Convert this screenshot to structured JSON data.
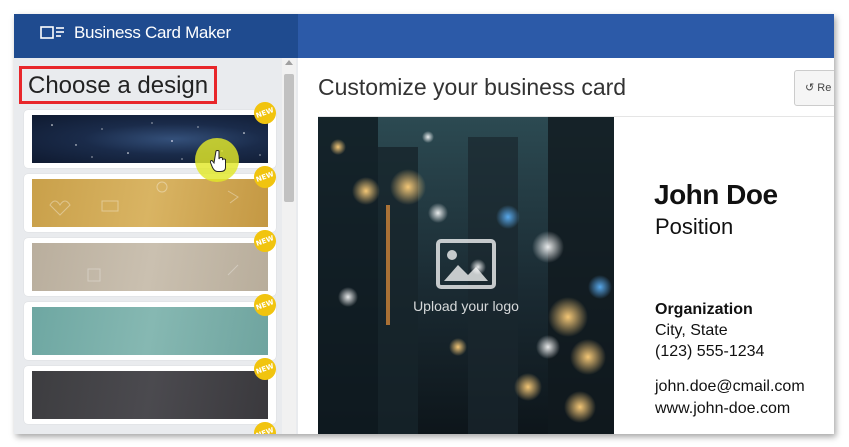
{
  "app": {
    "title": "Business Card Maker"
  },
  "sidebar": {
    "title": "Choose a design",
    "badge_label": "NEW",
    "designs": [
      {
        "name": "night-sky",
        "badge": "NEW"
      },
      {
        "name": "gold",
        "badge": "NEW"
      },
      {
        "name": "taupe",
        "badge": "NEW"
      },
      {
        "name": "teal",
        "badge": "NEW"
      },
      {
        "name": "charcoal",
        "badge": "NEW"
      }
    ]
  },
  "main": {
    "title": "Customize your business card",
    "reset_label": "Re"
  },
  "card": {
    "upload_label": "Upload your logo",
    "name": "John Doe",
    "position": "Position",
    "organization": "Organization",
    "city_state": "City, State",
    "phone": "(123) 555-1234",
    "email": "john.doe@cmail.com",
    "website": "www.john-doe.com"
  },
  "colors": {
    "header_left": "#1f4b8f",
    "header_right": "#2c5aa8",
    "highlight_border": "#e8262a",
    "badge": "#f1c40f",
    "cursor_halo": "#e2e828"
  }
}
